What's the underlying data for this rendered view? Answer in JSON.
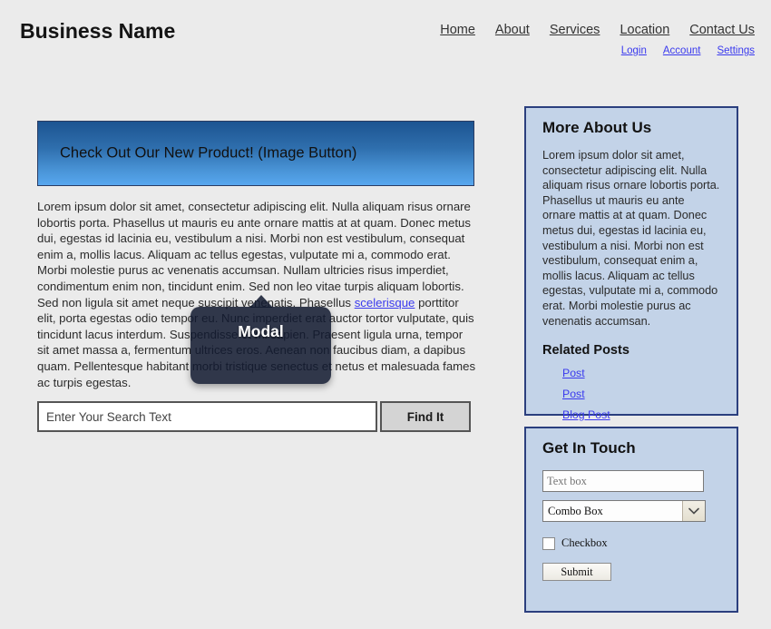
{
  "header": {
    "brand": "Business Name",
    "primary_nav": [
      {
        "label": "Home"
      },
      {
        "label": "About"
      },
      {
        "label": "Services"
      },
      {
        "label": "Location"
      },
      {
        "label": "Contact Us"
      }
    ],
    "secondary_nav": [
      {
        "label": "Login"
      },
      {
        "label": "Account"
      },
      {
        "label": "Settings"
      }
    ]
  },
  "main": {
    "hero_button_label": "Check Out Our New Product! (Image Button)",
    "body_copy_part1": "Lorem ipsum dolor sit amet, consectetur adipiscing elit. Nulla aliquam risus ornare lobortis porta. Phasellus ut mauris eu ante ornare mattis at at quam. Donec metus dui, egestas id lacinia eu, vestibulum a nisi. Morbi non est vestibulum, consequat enim a, mollis lacus. Aliquam ac tellus egestas, vulputate mi a, commodo erat. Morbi molestie purus ac venenatis accumsan. Nullam ultricies risus imperdiet, condimentum enim non, tincidunt enim. Sed non leo vitae turpis aliquam lobortis. Sed non ligula sit amet neque suscipit venenatis. Phasellus ",
    "body_copy_link": "scelerisque",
    "body_copy_part2": " porttitor elit, porta egestas odio tempor eu. Nunc imperdiet erat auctor tortor vulputate, quis tincidunt lacus interdum. Suspendisse et mi sapien. Praesent ligula urna, tempor sit amet massa a, fermentum ultrices eros. Aenean non faucibus diam, a dapibus quam. Pellentesque habitant morbi tristique senectus et netus et malesuada fames ac turpis egestas.",
    "search": {
      "placeholder": "Enter Your Search Text",
      "value": "",
      "button_label": "Find It"
    }
  },
  "modal": {
    "title": "Modal"
  },
  "sidebar": {
    "about_panel": {
      "heading": "More About Us",
      "paragraph": "Lorem ipsum dolor sit amet, consectetur adipiscing elit. Nulla aliquam risus ornare lobortis porta. Phasellus ut mauris eu ante ornare mattis at at quam. Donec metus dui, egestas id lacinia eu, vestibulum a nisi. Morbi non est vestibulum, consequat enim a, mollis lacus. Aliquam ac tellus egestas, vulputate mi a, commodo erat. Morbi molestie purus ac venenatis accumsan.",
      "related_heading": "Related Posts",
      "related_links": [
        {
          "label": "Post"
        },
        {
          "label": "Post"
        },
        {
          "label": "Blog Post"
        }
      ]
    },
    "contact_panel": {
      "heading": "Get In Touch",
      "text_box_value": "Text box",
      "text_box_placeholder": "Text box",
      "combo_box_value": "Combo Box",
      "combo_box_icon": "chevron-down-icon",
      "checkbox_label": "Checkbox",
      "checkbox_checked": false,
      "submit_label": "Submit"
    }
  },
  "colors": {
    "page_background": "#ebebeb",
    "panel_background": "#c3d3e8",
    "panel_border": "#2b3f7e",
    "link": "#3a3aee",
    "hero_gradient_top": "#1c5491",
    "hero_gradient_bottom": "#57a7ef",
    "modal_background": "rgba(17, 26, 48, 0.86)"
  }
}
